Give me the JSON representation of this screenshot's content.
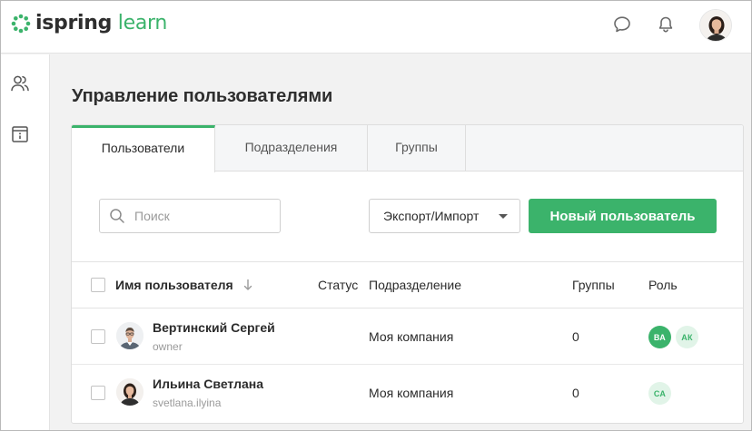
{
  "brand": {
    "name_part1": "ispring",
    "name_part2": "learn",
    "accent_color": "#3bb36b"
  },
  "header": {
    "icons": [
      "chat-icon",
      "bell-icon"
    ],
    "avatar": "user-avatar"
  },
  "sidebar": {
    "items": [
      {
        "icon": "users-icon"
      },
      {
        "icon": "info-box-icon"
      }
    ]
  },
  "page": {
    "title": "Управление пользователями"
  },
  "tabs": [
    {
      "label": "Пользователи",
      "active": true
    },
    {
      "label": "Подразделения",
      "active": false
    },
    {
      "label": "Группы",
      "active": false
    }
  ],
  "toolbar": {
    "search_placeholder": "Поиск",
    "export_label": "Экспорт/Импорт",
    "new_user_label": "Новый пользователь"
  },
  "table": {
    "columns": {
      "name": "Имя пользователя",
      "status": "Статус",
      "department": "Подразделение",
      "groups": "Группы",
      "role": "Роль"
    },
    "rows": [
      {
        "name": "Вертинский Сергей",
        "login": "owner",
        "status": "",
        "department": "Моя компания",
        "groups": "0",
        "roles": [
          {
            "label": "ВА",
            "style": "primary"
          },
          {
            "label": "АК",
            "style": "light"
          }
        ]
      },
      {
        "name": "Ильина Светлана",
        "login": "svetlana.ilyina",
        "status": "",
        "department": "Моя компания",
        "groups": "0",
        "roles": [
          {
            "label": "СА",
            "style": "light"
          }
        ]
      }
    ]
  }
}
